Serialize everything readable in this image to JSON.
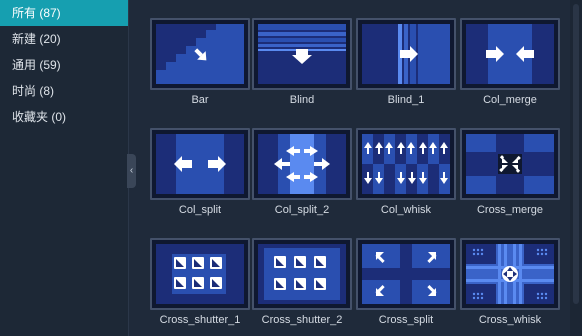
{
  "sidebar": {
    "categories": [
      {
        "label": "所有 (87)",
        "active": true
      },
      {
        "label": "新建 (20)",
        "active": false
      },
      {
        "label": "通用 (59)",
        "active": false
      },
      {
        "label": "时尚 (8)",
        "active": false
      },
      {
        "label": "收藏夹 (0)",
        "active": false
      }
    ]
  },
  "transitions": [
    {
      "name": "Bar",
      "icon": "bar-transition-icon"
    },
    {
      "name": "Blind",
      "icon": "blind-transition-icon"
    },
    {
      "name": "Blind_1",
      "icon": "blind-1-transition-icon"
    },
    {
      "name": "Col_merge",
      "icon": "col-merge-transition-icon"
    },
    {
      "name": "Col_split",
      "icon": "col-split-transition-icon"
    },
    {
      "name": "Col_split_2",
      "icon": "col-split-2-transition-icon"
    },
    {
      "name": "Col_whisk",
      "icon": "col-whisk-transition-icon"
    },
    {
      "name": "Cross_merge",
      "icon": "cross-merge-transition-icon"
    },
    {
      "name": "Cross_shutter_1",
      "icon": "cross-shutter-1-transition-icon"
    },
    {
      "name": "Cross_shutter_2",
      "icon": "cross-shutter-2-transition-icon"
    },
    {
      "name": "Cross_split",
      "icon": "cross-split-transition-icon"
    },
    {
      "name": "Cross_whisk",
      "icon": "cross-whisk-transition-icon"
    }
  ],
  "colors": {
    "accent": "#169fb0",
    "thumb_bg": "#0f1830",
    "thumb_blue": "#2a4fb0",
    "thumb_mid": "#1c2d78",
    "thumb_light": "#5a8af0"
  }
}
